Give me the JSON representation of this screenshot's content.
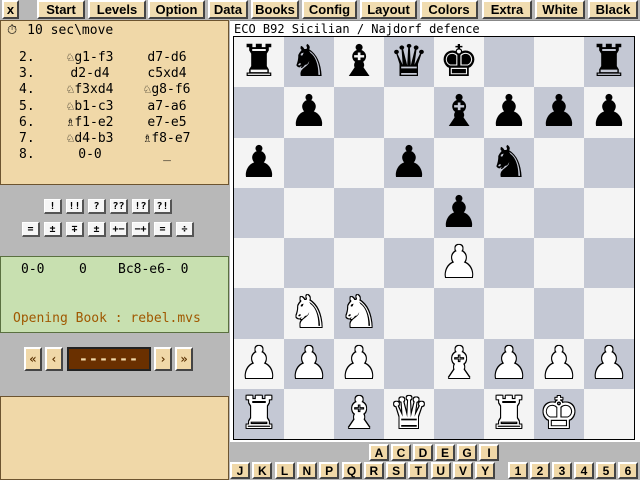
{
  "menu": {
    "close_label": "x",
    "items": [
      "Start",
      "Levels",
      "Option",
      "Data",
      "Books",
      "Config",
      "Layout",
      "Colors",
      "Extra",
      "White",
      "Black"
    ]
  },
  "time_setting": "10 sec\\move",
  "clock_icon": "clock-icon",
  "moves": [
    {
      "num": "2.",
      "white": "♘g1-f3",
      "black": "d7-d6"
    },
    {
      "num": "3.",
      "white": "d2-d4",
      "black": "c5xd4"
    },
    {
      "num": "4.",
      "white": "♘f3xd4",
      "black": "♘g8-f6"
    },
    {
      "num": "5.",
      "white": "♘b1-c3",
      "black": "a7-a6"
    },
    {
      "num": "6.",
      "white": "♗f1-e2",
      "black": "e7-e5"
    },
    {
      "num": "7.",
      "white": "♘d4-b3",
      "black": "♗f8-e7"
    },
    {
      "num": "8.",
      "white": "0-0",
      "black": "_"
    }
  ],
  "annotation_row1": [
    "!",
    "!!",
    "?",
    "??",
    "!?",
    "?!"
  ],
  "annotation_row2": [
    "=",
    "±",
    "∓",
    "±",
    "+−",
    "−+",
    "=",
    "÷"
  ],
  "info": {
    "last_move": "0-0",
    "score": "0",
    "best_line": "Bc8-e6- 0",
    "book_text": "Opening Book : rebel.mvs"
  },
  "nav": {
    "first_label": "«",
    "prev_label": "‹",
    "move_display": "------",
    "next_label": "›",
    "last_label": "»"
  },
  "board_title": "ECO B92 Sicilian / Najdorf defence",
  "board": [
    [
      "r",
      "n",
      "b",
      "q",
      "k",
      "",
      "",
      "r"
    ],
    [
      "",
      "p",
      "",
      "",
      "b",
      "p",
      "p",
      "p"
    ],
    [
      "p",
      "",
      "",
      "p",
      "",
      "n",
      "",
      ""
    ],
    [
      "",
      "",
      "",
      "",
      "p",
      "",
      "",
      ""
    ],
    [
      "",
      "",
      "",
      "",
      "P",
      "",
      "",
      ""
    ],
    [
      "",
      "N",
      "N",
      "",
      "",
      "",
      "",
      ""
    ],
    [
      "P",
      "P",
      "P",
      "",
      "B",
      "P",
      "P",
      "P"
    ],
    [
      "R",
      "",
      "B",
      "Q",
      "",
      "R",
      "K",
      ""
    ]
  ],
  "eco_row1": [
    "A",
    "C",
    "D",
    "E",
    "G",
    "I"
  ],
  "eco_row2": [
    "J",
    "K",
    "L",
    "N",
    "P",
    "Q",
    "R",
    "S",
    "T",
    "U",
    "V",
    "Y",
    "1",
    "2",
    "3",
    "4",
    "5",
    "6"
  ]
}
